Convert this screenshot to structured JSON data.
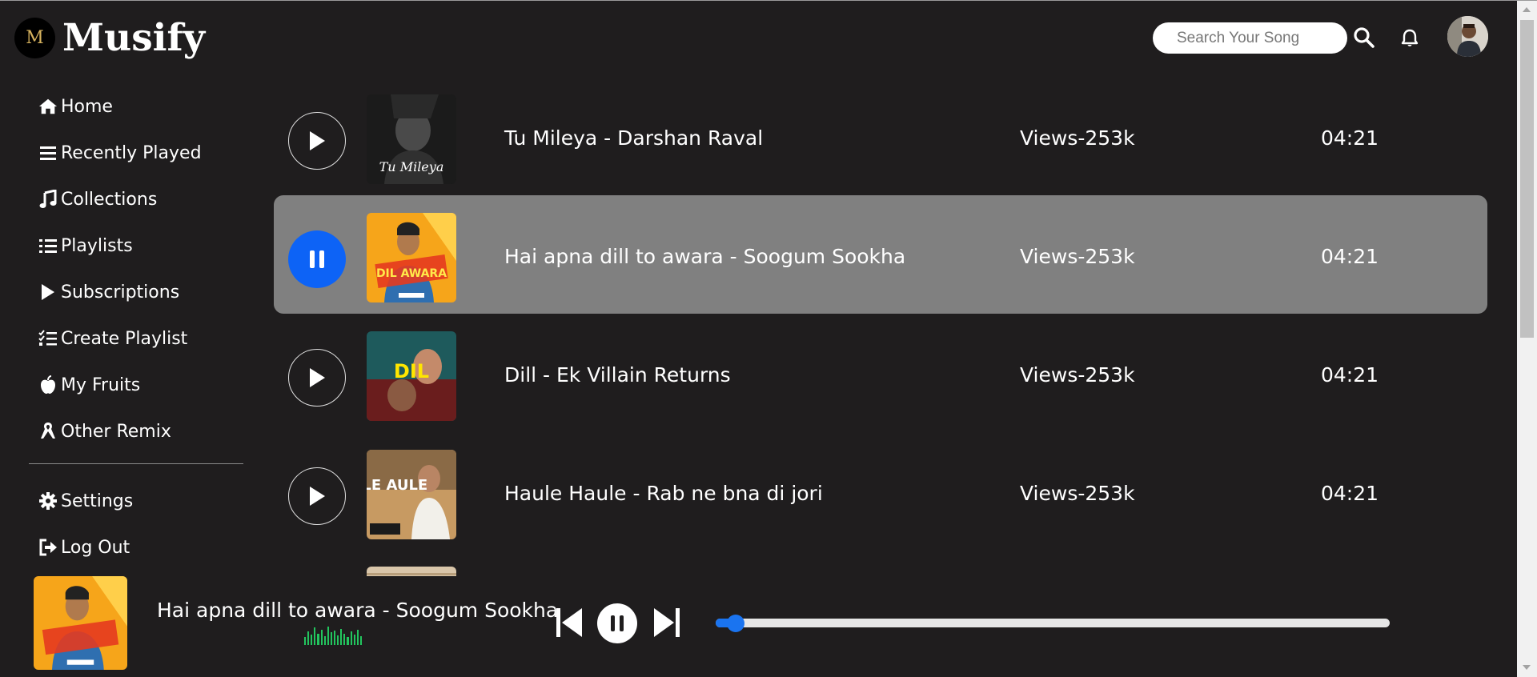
{
  "app": {
    "logo_letter": "M",
    "name": "Musify"
  },
  "header": {
    "search_placeholder": "Search Your Song"
  },
  "sidebar": {
    "items": [
      {
        "label": "Home",
        "icon": "home-icon"
      },
      {
        "label": "Recently Played",
        "icon": "list-icon"
      },
      {
        "label": "Collections",
        "icon": "music-note-icon"
      },
      {
        "label": "Playlists",
        "icon": "list-ul-icon"
      },
      {
        "label": "Subscriptions",
        "icon": "play-icon"
      },
      {
        "label": "Create Playlist",
        "icon": "checklist-icon"
      },
      {
        "label": "My Fruits",
        "icon": "apple-icon"
      },
      {
        "label": "Other Remix",
        "icon": "ribbon-icon"
      }
    ],
    "bottom_items": [
      {
        "label": "Settings",
        "icon": "gear-icon"
      },
      {
        "label": "Log Out",
        "icon": "logout-icon"
      }
    ]
  },
  "songs": [
    {
      "title": "Tu Mileya - Darshan Raval",
      "views": "Views-253k",
      "duration": "04:21",
      "cover_text": "Tu Mileya",
      "playing": false
    },
    {
      "title": "Hai apna dill to awara - Soogum Sookha",
      "views": "Views-253k",
      "duration": "04:21",
      "cover_text": "DIL AWARA",
      "playing": true
    },
    {
      "title": "Dill - Ek Villain Returns",
      "views": "Views-253k",
      "duration": "04:21",
      "cover_text": "DIL",
      "playing": false
    },
    {
      "title": "Haule Haule - Rab ne bna di jori",
      "views": "Views-253k",
      "duration": "04:21",
      "cover_text": "ULE AULE",
      "playing": false
    }
  ],
  "player": {
    "title": "Hai apna dill to awara - Soogum Sookha",
    "progress": 0.03
  },
  "colors": {
    "accent": "#0d63f6",
    "active_row": "#808080",
    "background": "#1f1d1e",
    "equalizer": "#22c55e"
  }
}
